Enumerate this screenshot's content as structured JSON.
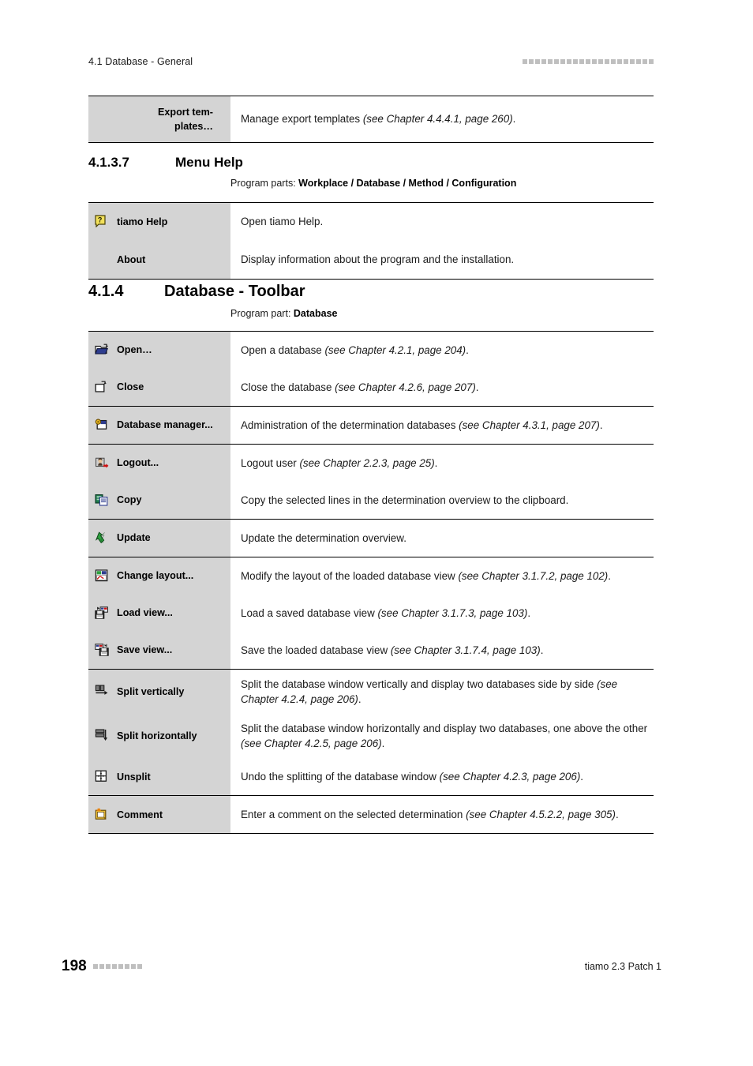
{
  "header": {
    "section_label": "4.1 Database - General",
    "decor_squares": 21
  },
  "footer": {
    "page_number": "198",
    "decor_squares": 8,
    "product": "tiamo 2.3 Patch 1"
  },
  "top_table": {
    "rows": [
      {
        "icon": "none",
        "label": "Export tem-\nplates…",
        "label_line1": "Export tem-",
        "label_line2": "plates…",
        "desc_plain": "Manage export templates ",
        "desc_italic": "(see Chapter 4.4.4.1, page 260)",
        "desc_tail": "."
      }
    ]
  },
  "section_help": {
    "number": "4.1.3.7",
    "title": "Menu Help",
    "program_prefix": "Program parts: ",
    "program_value": "Workplace / Database / Method / Configuration",
    "rows": [
      {
        "icon": "help-question-icon",
        "label": "tiamo Help",
        "desc_plain": "Open tiamo Help.",
        "desc_italic": "",
        "desc_tail": ""
      },
      {
        "icon": "none",
        "label": "About",
        "desc_plain": "Display information about the program and the installation.",
        "desc_italic": "",
        "desc_tail": ""
      }
    ]
  },
  "section_toolbar": {
    "number": "4.1.4",
    "title": "Database - Toolbar",
    "program_prefix": "Program part: ",
    "program_value": "Database",
    "groups": [
      {
        "rows": [
          {
            "icon": "open-folder-icon",
            "label": "Open…",
            "desc_plain": "Open a database ",
            "desc_italic": "(see Chapter 4.2.1, page 204)",
            "desc_tail": "."
          },
          {
            "icon": "close-document-icon",
            "label": "Close",
            "desc_plain": "Close the database ",
            "desc_italic": "(see Chapter 4.2.6, page 207)",
            "desc_tail": "."
          }
        ]
      },
      {
        "rows": [
          {
            "icon": "database-manager-icon",
            "label": "Database manager...",
            "desc_plain": "Administration of the determination databases ",
            "desc_italic": "(see Chapter 4.3.1, page 207)",
            "desc_tail": "."
          }
        ]
      },
      {
        "rows": [
          {
            "icon": "logout-user-icon",
            "label": "Logout...",
            "desc_plain": "Logout user ",
            "desc_italic": "(see Chapter 2.2.3, page 25)",
            "desc_tail": "."
          },
          {
            "icon": "copy-icon",
            "label": "Copy",
            "desc_plain": "Copy the selected lines in the determination overview to the clipboard.",
            "desc_italic": "",
            "desc_tail": ""
          }
        ]
      },
      {
        "rows": [
          {
            "icon": "update-refresh-icon",
            "label": "Update",
            "desc_plain": "Update the determination overview.",
            "desc_italic": "",
            "desc_tail": ""
          }
        ]
      },
      {
        "rows": [
          {
            "icon": "change-layout-icon",
            "label": "Change layout...",
            "desc_plain": "Modify the layout of the loaded database view ",
            "desc_italic": "(see Chapter 3.1.7.2, page 102)",
            "desc_tail": "."
          },
          {
            "icon": "load-view-icon",
            "label": "Load view...",
            "desc_plain": "Load a saved database view ",
            "desc_italic": "(see Chapter 3.1.7.3, page 103)",
            "desc_tail": "."
          },
          {
            "icon": "save-view-icon",
            "label": "Save view...",
            "desc_plain": "Save the loaded database view ",
            "desc_italic": "(see Chapter 3.1.7.4, page 103)",
            "desc_tail": "."
          }
        ]
      },
      {
        "rows": [
          {
            "icon": "split-vertically-icon",
            "label": "Split vertically",
            "desc_plain": "Split the database window vertically and display two databases side by side ",
            "desc_italic": "(see Chapter 4.2.4, page 206)",
            "desc_tail": "."
          },
          {
            "icon": "split-horizontally-icon",
            "label": "Split horizontally",
            "desc_plain": "Split the database window horizontally and display two databases, one above the other ",
            "desc_italic": "(see Chapter 4.2.5, page 206)",
            "desc_tail": "."
          },
          {
            "icon": "unsplit-icon",
            "label": "Unsplit",
            "desc_plain": "Undo the splitting of the database window ",
            "desc_italic": "(see Chapter 4.2.3, page 206)",
            "desc_tail": "."
          }
        ]
      },
      {
        "rows": [
          {
            "icon": "comment-icon",
            "label": "Comment",
            "desc_plain": "Enter a comment on the selected determination ",
            "desc_italic": "(see Chapter 4.5.2.2, page 305)",
            "desc_tail": "."
          }
        ]
      }
    ]
  }
}
